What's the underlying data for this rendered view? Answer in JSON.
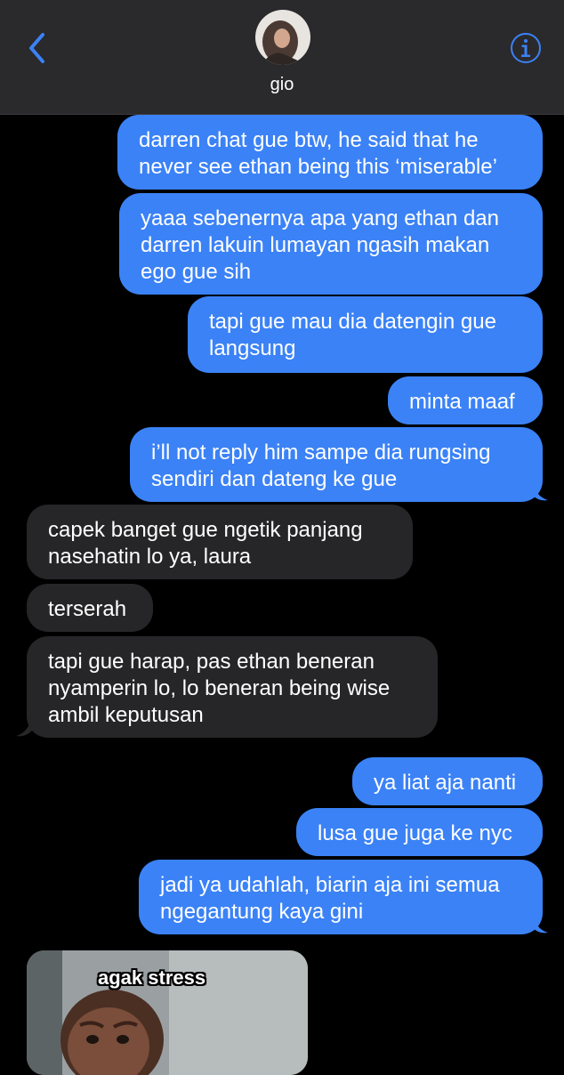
{
  "header": {
    "contact_name": "gio"
  },
  "messages": [
    {
      "dir": "out",
      "text": "darren chat gue btw, he said that he\nnever see ethan being this ‘miserable’"
    },
    {
      "dir": "out",
      "text": "yaaa sebenernya apa yang ethan dan\ndarren lakuin lumayan ngasih makan\nego gue sih"
    },
    {
      "dir": "out",
      "text": "tapi gue mau dia datengin gue\nlangsung"
    },
    {
      "dir": "out",
      "text": "minta maaf"
    },
    {
      "dir": "out",
      "text": "i’ll not reply him sampe dia rungsing\nsendiri dan dateng ke gue"
    },
    {
      "dir": "in",
      "text": "capek banget gue ngetik panjang\nnasehatin lo ya, laura"
    },
    {
      "dir": "in",
      "text": "terserah"
    },
    {
      "dir": "in",
      "text": "tapi gue harap, pas ethan beneran\nnyamperin lo, lo beneran being wise\nambil keputusan"
    },
    {
      "dir": "out",
      "text": "ya liat aja nanti"
    },
    {
      "dir": "out",
      "text": "lusa gue juga ke nyc"
    },
    {
      "dir": "out",
      "text": "jadi ya udahlah, biarin aja ini semua\nngegantung kaya gini"
    }
  ],
  "sticker": {
    "caption": "agak stress"
  },
  "colors": {
    "accent": "#3b82f6",
    "incoming": "#262628",
    "header_bg": "#2a2a2c"
  }
}
